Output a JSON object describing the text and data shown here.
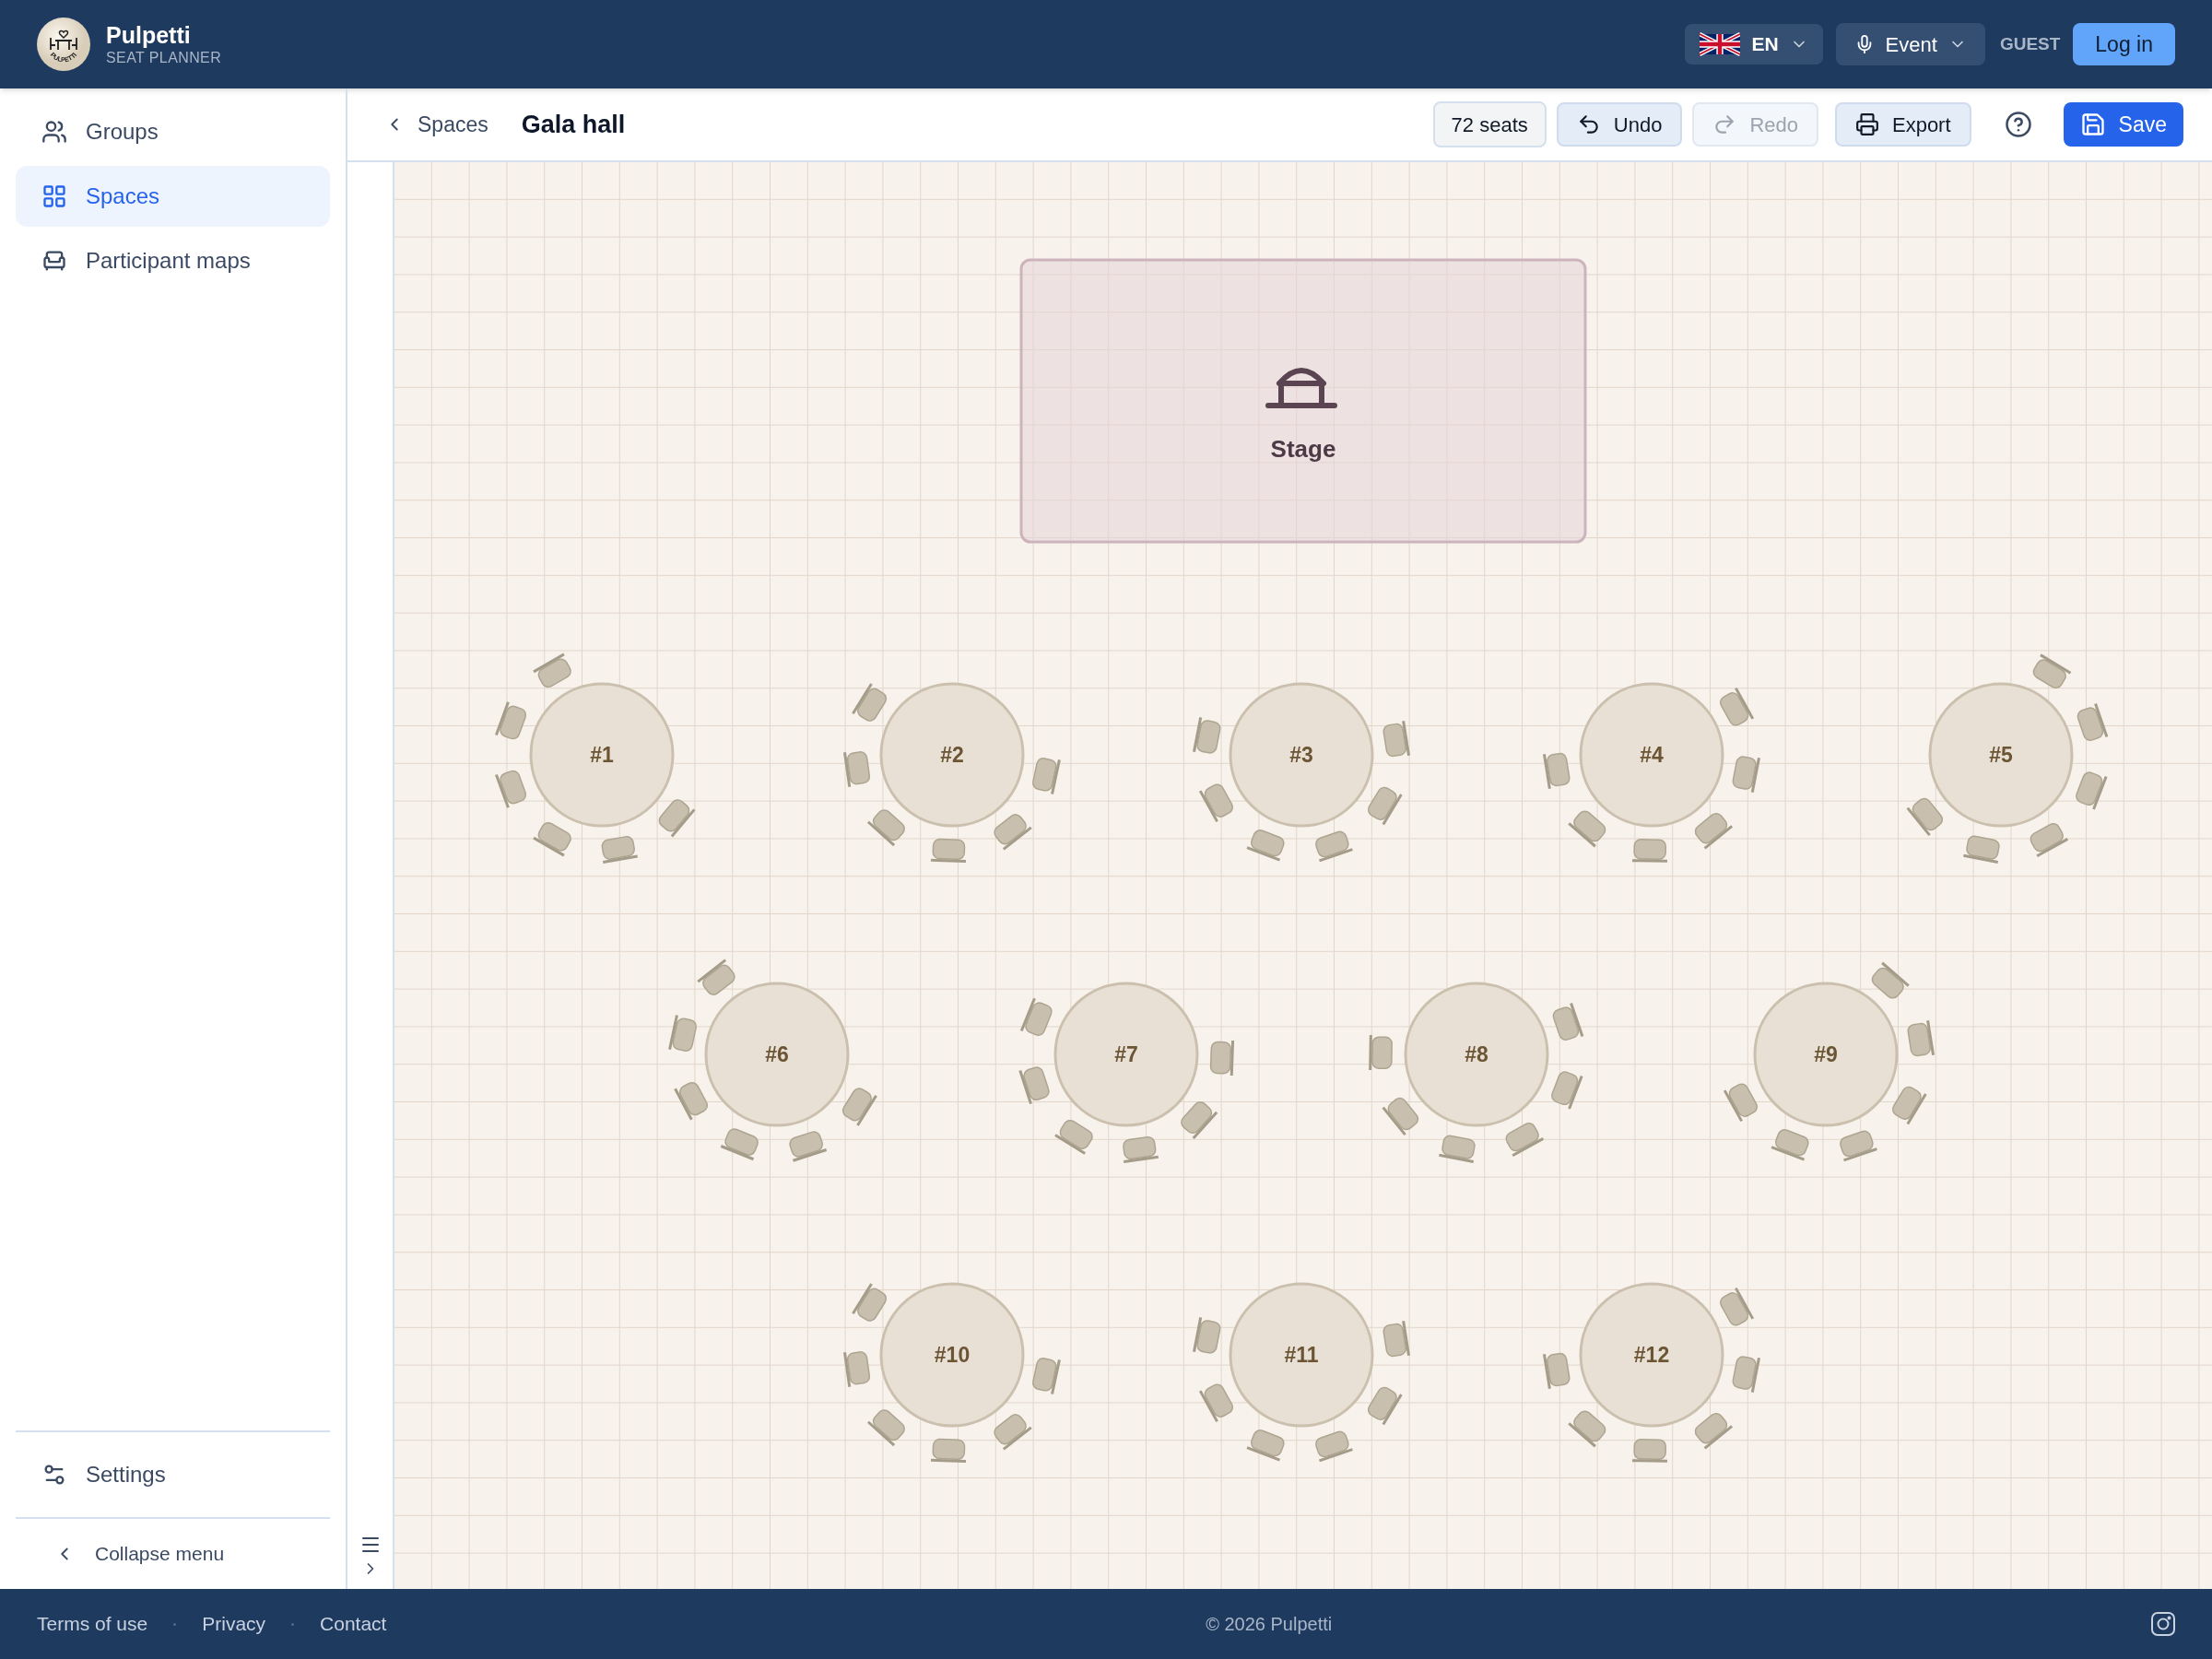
{
  "header": {
    "brand": "Pulpetti",
    "subtitle": "SEAT PLANNER",
    "logo_text": "PULPETTI",
    "language": "EN",
    "mode": "Event",
    "user": "GUEST",
    "login": "Log in"
  },
  "sidebar": {
    "items": [
      {
        "label": "Groups",
        "kind": "groups",
        "selected": false
      },
      {
        "label": "Spaces",
        "kind": "spaces",
        "selected": true
      },
      {
        "label": "Participant maps",
        "kind": "maps",
        "selected": false
      }
    ],
    "settings": "Settings",
    "collapse": "Collapse menu"
  },
  "toolbar": {
    "breadcrumb": "Spaces",
    "title": "Gala hall",
    "seats": "72 seats",
    "buttons": [
      {
        "label": "Undo",
        "kind": "undo",
        "disabled": false
      },
      {
        "label": "Redo",
        "kind": "redo",
        "disabled": true
      },
      {
        "label": "Export",
        "kind": "export",
        "disabled": false
      }
    ],
    "save": "Save"
  },
  "canvas": {
    "stage": "Stage",
    "tables": [
      {
        "label": "#1"
      },
      {
        "label": "#2"
      },
      {
        "label": "#3"
      },
      {
        "label": "#4"
      },
      {
        "label": "#5"
      },
      {
        "label": "#6"
      },
      {
        "label": "#7"
      },
      {
        "label": "#8"
      },
      {
        "label": "#9"
      },
      {
        "label": "#10"
      },
      {
        "label": "#11"
      },
      {
        "label": "#12"
      }
    ]
  },
  "footer": {
    "links": [
      "Terms of use",
      "Privacy",
      "Contact"
    ],
    "copyright": "© 2026 Pulpetti"
  }
}
